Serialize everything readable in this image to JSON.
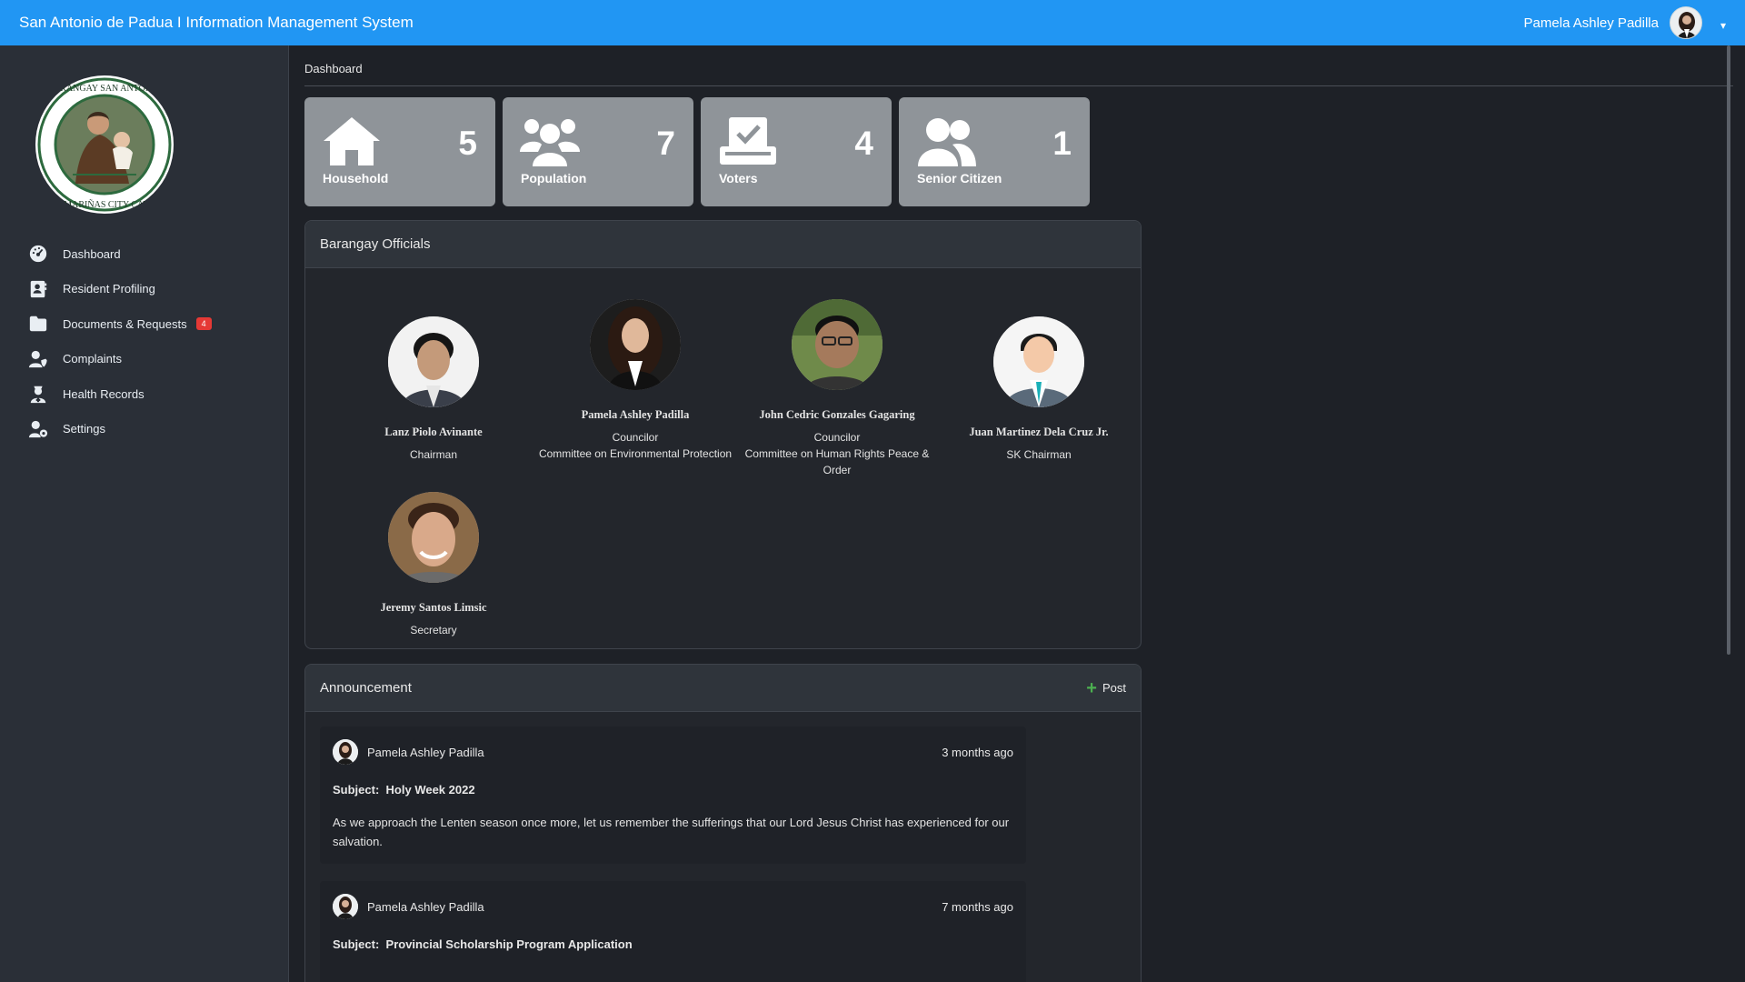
{
  "topbar": {
    "title": "San Antonio de Padua I Information Management System",
    "user_name": "Pamela Ashley Padilla",
    "caret": "▾"
  },
  "sidebar": {
    "logo_alt": "BARANGAY SAN ANTONIO DE PADUA I DASMARIÑAS CITY CAVITE",
    "items": [
      {
        "label": "Dashboard",
        "icon": "dashboard-icon"
      },
      {
        "label": "Resident Profiling",
        "icon": "id-card-icon"
      },
      {
        "label": "Documents & Requests",
        "icon": "folder-icon",
        "badge": "4"
      },
      {
        "label": "Complaints",
        "icon": "user-shield-icon"
      },
      {
        "label": "Health Records",
        "icon": "user-nurse-icon"
      },
      {
        "label": "Settings",
        "icon": "user-gear-icon"
      }
    ]
  },
  "breadcrumb": "Dashboard",
  "stats": [
    {
      "label": "Household",
      "value": "5",
      "icon": "home-icon"
    },
    {
      "label": "Population",
      "value": "7",
      "icon": "users-icon"
    },
    {
      "label": "Voters",
      "value": "4",
      "icon": "vote-icon"
    },
    {
      "label": "Senior Citizen",
      "value": "1",
      "icon": "user-friends-icon"
    }
  ],
  "officials": {
    "title": "Barangay Officials",
    "people": [
      {
        "name": "Lanz Piolo Avinante",
        "position": "Chairman",
        "committee": ""
      },
      {
        "name": "Pamela Ashley Padilla",
        "position": "Councilor",
        "committee": "Committee on Environmental Protection"
      },
      {
        "name": "John Cedric Gonzales Gagaring",
        "position": "Councilor",
        "committee": "Committee on Human Rights Peace & Order"
      },
      {
        "name": "Juan Martinez Dela Cruz Jr.",
        "position": "SK Chairman",
        "committee": ""
      },
      {
        "name": "Jeremy Santos Limsic",
        "position": "Secretary",
        "committee": ""
      }
    ]
  },
  "announcement": {
    "title": "Announcement",
    "post_label": "Post",
    "posts": [
      {
        "author": "Pamela Ashley Padilla",
        "time": "3 months ago",
        "subject_label": "Subject:",
        "subject": "Holy Week 2022",
        "body": "As we approach the Lenten season once more, let us remember the sufferings that our Lord Jesus Christ has experienced for our salvation."
      },
      {
        "author": "Pamela Ashley Padilla",
        "time": "7 months ago",
        "subject_label": "Subject:",
        "subject": "Provincial Scholarship Program Application",
        "body": ""
      }
    ]
  },
  "colors": {
    "topbar": "#2196f3",
    "sidebar": "#2a2f37",
    "background": "#1e2127",
    "stat_card": "#8f9499",
    "badge": "#e53935",
    "post_plus": "#4caf50"
  }
}
